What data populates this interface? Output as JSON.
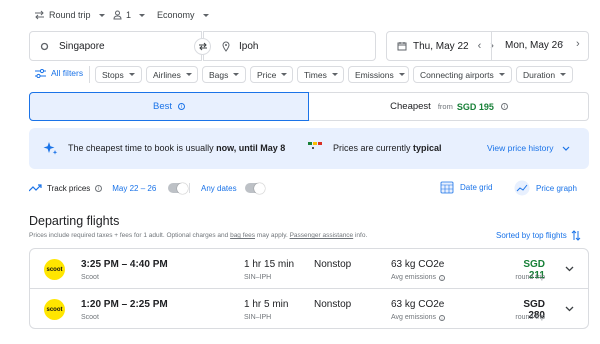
{
  "trip_options": {
    "trip_type": "Round trip",
    "passengers": "1",
    "cabin": "Economy"
  },
  "search": {
    "origin": "Singapore",
    "destination": "Ipoh",
    "depart_date": "Thu, May 22",
    "return_date": "Mon, May 26"
  },
  "filters": {
    "all_filters": "All filters",
    "chips": [
      "Stops",
      "Airlines",
      "Bags",
      "Price",
      "Times",
      "Emissions",
      "Connecting airports",
      "Duration"
    ]
  },
  "sort_tabs": {
    "best": "Best",
    "cheapest": "Cheapest",
    "cheapest_from": "from",
    "cheapest_price": "SGD 195"
  },
  "insights": {
    "booking_text": "The cheapest time to book is usually ",
    "booking_bold": "now, until May 8",
    "price_text": "Prices are currently ",
    "price_bold": "typical",
    "history_link": "View price history"
  },
  "tools": {
    "track_prices": "Track prices",
    "track_dates": "May 22 – 26",
    "any_dates": "Any dates",
    "date_grid": "Date grid",
    "price_graph": "Price graph"
  },
  "results": {
    "heading": "Departing flights",
    "note_part1": "Prices include required taxes + fees for 1 adult. Optional charges and ",
    "note_link1": "bag fees",
    "note_part2": " may apply. ",
    "note_link2": "Passenger assistance",
    "note_part3": " info.",
    "sort_label": "Sorted by top flights",
    "flights": [
      {
        "airline_logo": "scoot",
        "times": "3:25 PM – 4:40 PM",
        "airline": "Scoot",
        "duration": "1 hr 15 min",
        "route": "SIN–IPH",
        "stops": "Nonstop",
        "emissions": "63 kg CO2e",
        "emissions_note": "Avg emissions",
        "price": "SGD 211",
        "price_type": "round trip",
        "price_color": "#188038"
      },
      {
        "airline_logo": "scoot",
        "times": "1:20 PM – 2:25 PM",
        "airline": "Scoot",
        "duration": "1 hr 5 min",
        "route": "SIN–IPH",
        "stops": "Nonstop",
        "emissions": "63 kg CO2e",
        "emissions_note": "Avg emissions",
        "price": "SGD 280",
        "price_type": "round trip",
        "price_color": "#202124"
      }
    ]
  },
  "colors": {
    "accent": "#1a73e8",
    "selected_tab_bg": "#e8f0fe",
    "cheap_price": "#188038"
  }
}
